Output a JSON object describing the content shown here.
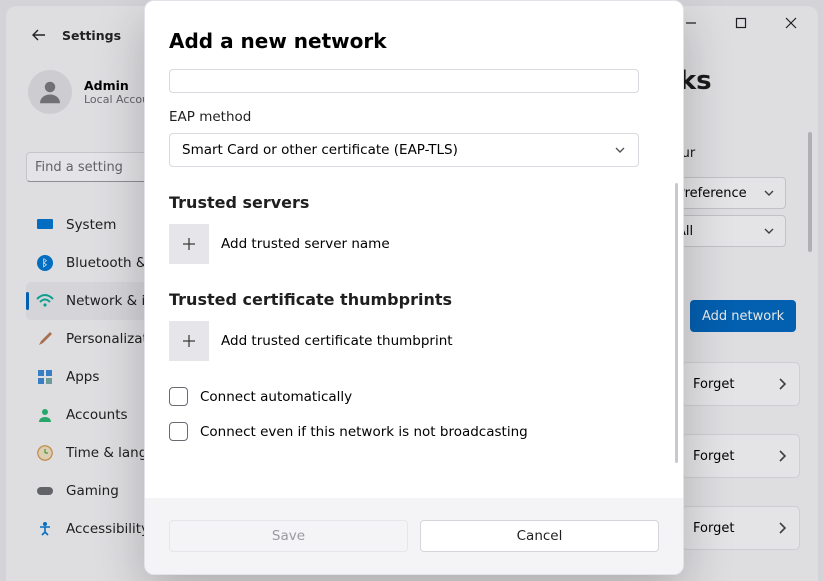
{
  "window": {
    "title": "Settings",
    "user_name": "Admin",
    "user_account": "Local Account",
    "search_placeholder": "Find a setting"
  },
  "sidebar": {
    "items": [
      {
        "label": "System",
        "icon": "monitor-icon"
      },
      {
        "label": "Bluetooth & devices",
        "icon": "bluetooth-icon"
      },
      {
        "label": "Network & internet",
        "icon": "wifi-icon"
      },
      {
        "label": "Personalization",
        "icon": "brush-icon"
      },
      {
        "label": "Apps",
        "icon": "apps-icon"
      },
      {
        "label": "Accounts",
        "icon": "person-icon"
      },
      {
        "label": "Time & language",
        "icon": "clock-icon"
      },
      {
        "label": "Gaming",
        "icon": "gamepad-icon"
      },
      {
        "label": "Accessibility",
        "icon": "accessibility-icon"
      }
    ]
  },
  "background_page": {
    "header_suffix": "rks",
    "help_text_fragment": "your",
    "sort_label": "Preference",
    "filter_label": "All",
    "add_network_button": "Add network",
    "known_network_action": "Forget"
  },
  "modal": {
    "title": "Add a new network",
    "eap_label": "EAP method",
    "eap_value": "Smart Card or other certificate (EAP-TLS)",
    "trusted_servers_heading": "Trusted servers",
    "add_trusted_server_label": "Add trusted server name",
    "thumbprints_heading": "Trusted certificate thumbprints",
    "add_thumbprint_label": "Add trusted certificate thumbprint",
    "connect_auto_label": "Connect automatically",
    "connect_hidden_label": "Connect even if this network is not broadcasting",
    "save_button": "Save",
    "cancel_button": "Cancel"
  }
}
